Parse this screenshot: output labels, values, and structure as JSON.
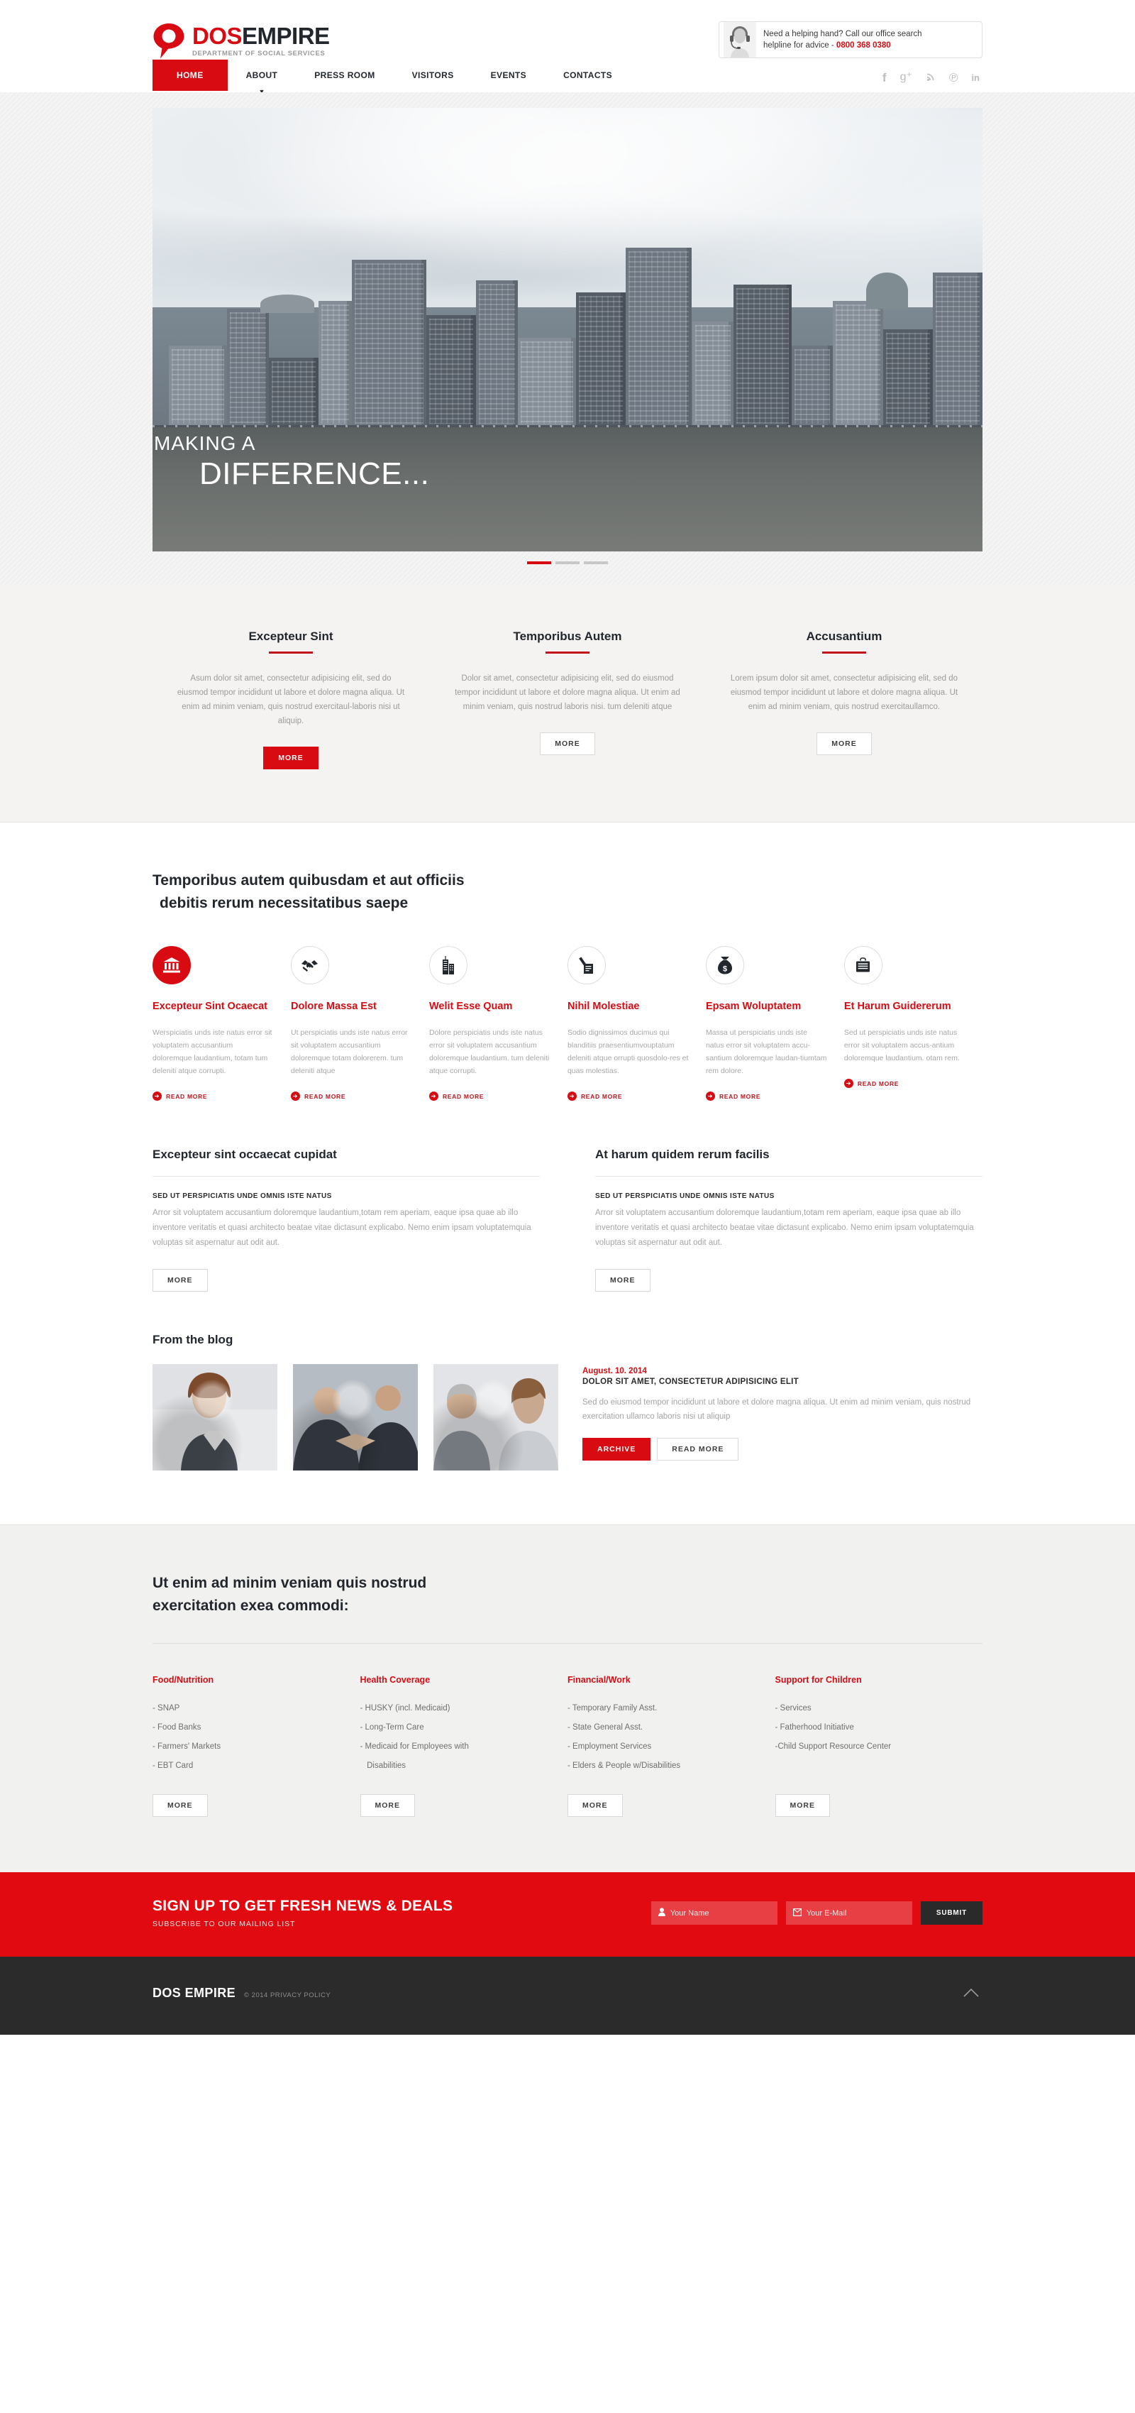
{
  "brand": {
    "name_part1": "DOS",
    "name_part2": "EMPIRE",
    "tagline": "DEPARTMENT OF SOCIAL SERVICES"
  },
  "header": {
    "helpline_line1": "Need a helping hand? Call our office search",
    "helpline_line2_prefix": "helpline for advice - ",
    "helpline_number": "0800 368 0380"
  },
  "nav": {
    "items": [
      {
        "label": "HOME",
        "active": true,
        "caret": false
      },
      {
        "label": "ABOUT",
        "active": false,
        "caret": true
      },
      {
        "label": "PRESS ROOM",
        "active": false,
        "caret": false
      },
      {
        "label": "VISITORS",
        "active": false,
        "caret": false
      },
      {
        "label": "EVENTS",
        "active": false,
        "caret": false
      },
      {
        "label": "CONTACTS",
        "active": false,
        "caret": false
      }
    ],
    "social": [
      {
        "name": "facebook-icon",
        "glyph": "f"
      },
      {
        "name": "google-plus-icon",
        "glyph": "g⁺"
      },
      {
        "name": "rss-icon",
        "glyph": "⦸"
      },
      {
        "name": "pinterest-icon",
        "glyph": "℗"
      },
      {
        "name": "linkedin-icon",
        "glyph": "in"
      }
    ]
  },
  "hero": {
    "line1": "MAKING A",
    "line2": "DIFFERENCE...",
    "slides": [
      {
        "active": true
      },
      {
        "active": false
      },
      {
        "active": false
      }
    ]
  },
  "intro_columns": [
    {
      "title": "Excepteur Sint",
      "body": "Asum dolor sit amet, consectetur adipisicing elit, sed do eiusmod tempor incididunt ut labore et dolore magna aliqua. Ut enim ad minim veniam, quis nostrud exercitaul-laboris nisi ut aliquip.",
      "button": "MORE",
      "button_style": "red"
    },
    {
      "title": "Temporibus Autem",
      "body": "Dolor sit amet, consectetur adipisicing elit, sed do eiusmod tempor incididunt ut labore et dolore magna aliqua. Ut enim ad minim veniam, quis nostrud laboris nisi. tum deleniti atque",
      "button": "MORE",
      "button_style": "plain"
    },
    {
      "title": "Accusantium",
      "body": "Lorem ipsum dolor sit amet, consectetur adipisicing elit, sed do eiusmod tempor incididunt ut labore et dolore magna aliqua. Ut enim ad minim veniam, quis nostrud exercitaullamco.",
      "button": "MORE",
      "button_style": "plain"
    }
  ],
  "services": {
    "heading_line1": "Temporibus autem quibusdam et aut officiis",
    "heading_line2": "debitis rerum necessitatibus saepe",
    "readmore_label": "READ MORE",
    "items": [
      {
        "icon": "bank-icon",
        "icon_filled": true,
        "title": "Excepteur Sint Ocaecat",
        "body": "Werspiciatis unds iste natus error sit voluptatem accusantium doloremque laudantium, totam tum deleniti atque corrupti."
      },
      {
        "icon": "handshake-icon",
        "icon_filled": false,
        "title": "Dolore Massa Est",
        "body": "Ut perspiciatis unds iste natus error sit voluptatem accusantium doloremque totam dolorerem. tum deleniti atque"
      },
      {
        "icon": "buildings-icon",
        "icon_filled": false,
        "title": "Welit Esse Quam",
        "body": "Dolore perspiciatis unds iste natus error sit voluptatem accusantium doloremque laudantium. tum deleniti atque corrupti."
      },
      {
        "icon": "pen-document-icon",
        "icon_filled": false,
        "title": "Nihil Molestiae",
        "body": "Sodio dignissimos ducimus qui blanditiis praesentiumvouptatum deleniti atque orrupti quosdolo-res et quas molestias."
      },
      {
        "icon": "money-bag-icon",
        "icon_filled": false,
        "title": "Epsam Woluptatem",
        "body": "Massa ut perspiciatis unds iste natus error sit voluptatem accu-santium doloremque laudan-tiumtam rem dolore."
      },
      {
        "icon": "briefcase-icon",
        "icon_filled": false,
        "title": "Et Harum Guidererum",
        "body": "Sed ut perspiciatis unds iste natus error sit voluptatem accus-antium doloremque laudantium. otam rem."
      }
    ]
  },
  "two_columns": [
    {
      "heading": "Excepteur sint occaecat cupidat",
      "subheading": "SED UT PERSPICIATIS UNDE OMNIS ISTE NATUS",
      "body": "Arror sit voluptatem accusantium doloremque laudantium,totam rem aperiam, eaque ipsa quae ab illo inventore veritatis et quasi architecto beatae vitae dictasunt explicabo. Nemo enim ipsam voluptatemquia voluptas sit aspernatur aut odit aut.",
      "button": "MORE"
    },
    {
      "heading": "At harum quidem rerum facilis",
      "subheading": "SED UT PERSPICIATIS UNDE OMNIS ISTE NATUS",
      "body": "Arror sit voluptatem accusantium doloremque laudantium,totam rem aperiam, eaque ipsa quae ab illo inventore veritatis et quasi architecto beatae vitae dictasunt explicabo. Nemo enim ipsam voluptatemquia voluptas sit aspernatur aut odit aut.",
      "button": "MORE"
    }
  ],
  "blog": {
    "heading": "From the blog",
    "thumbs": [
      {
        "name": "blog-thumb-woman"
      },
      {
        "name": "blog-thumb-handshake"
      },
      {
        "name": "blog-thumb-couple"
      }
    ],
    "post": {
      "date": "August. 10. 2014",
      "title": "DOLOR SIT AMET, CONSECTETUR ADIPISICING ELIT",
      "body": "Sed do eiusmod tempor incididunt ut labore et dolore magna aliqua. Ut enim ad minim veniam, quis nostrud exercitation ullamco laboris nisi ut aliquip",
      "archive_button": "ARCHIVE",
      "readmore_button": "READ MORE"
    }
  },
  "programs": {
    "heading_line1": "Ut enim ad minim veniam quis nostrud",
    "heading_line2": "exercitation exea commodi:",
    "columns": [
      {
        "title": "Food/Nutrition",
        "items": [
          "- SNAP",
          "- Food Banks",
          "- Farmers' Markets",
          "- EBT Card"
        ],
        "button": "MORE"
      },
      {
        "title": "Health Coverage",
        "items": [
          "- HUSKY (incl. Medicaid)",
          "- Long-Term Care",
          "- Medicaid for Employees with",
          "   Disabilities"
        ],
        "button": "MORE"
      },
      {
        "title": "Financial/Work",
        "items": [
          "- Temporary Family Asst.",
          "- State General Asst.",
          "- Employment Services",
          "- Elders & People w/Disabilities"
        ],
        "button": "MORE"
      },
      {
        "title": "Support for Children",
        "items": [
          "- Services",
          "- Fatherhood Initiative",
          "-Child Support Resource Center"
        ],
        "button": "MORE"
      }
    ]
  },
  "newsletter": {
    "heading": "SIGN UP TO GET FRESH NEWS & DEALS",
    "subheading": "SUBSCRIBE TO OUR MAILING LIST",
    "name_placeholder": "Your Name",
    "email_placeholder": "Your E-Mail",
    "submit_label": "SUBMIT"
  },
  "footer": {
    "brand": "DOS EMPIRE",
    "copyright": "© 2014 PRIVACY POLICY",
    "to_top_icon": "chevron-up-icon"
  },
  "colors": {
    "accent": "#d80b12",
    "accent_dark": "#c4121a",
    "dark": "#22272e",
    "footer_bg": "#2b2b2b",
    "band_bg": "#f4f3f1"
  }
}
